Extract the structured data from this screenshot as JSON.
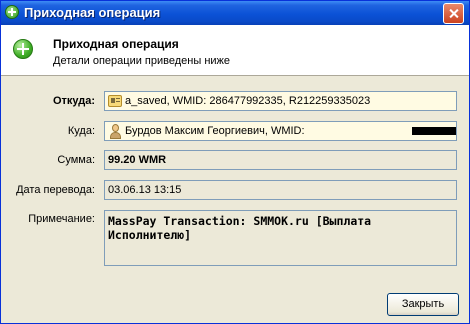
{
  "window": {
    "title": "Приходная операция",
    "close_icon": "close-icon",
    "app_icon": "add-circle-icon"
  },
  "header": {
    "title": "Приходная операция",
    "subtitle": "Детали операции приведены ниже",
    "icon": "add-circle-icon"
  },
  "form": {
    "from": {
      "label": "Откуда:",
      "value": "a_saved, WMID: 286477992335, R212259335023",
      "icon": "purse-icon"
    },
    "to": {
      "label": "Куда:",
      "value": "Бурдов Максим Георгиевич, WMID:",
      "icon": "person-icon"
    },
    "amount": {
      "label": "Сумма:",
      "value": "99.20 WMR"
    },
    "date": {
      "label": "Дата перевода:",
      "value": "03.06.13 13:15"
    },
    "note": {
      "label": "Примечание:",
      "value": "MassPay Transaction: SMMOK.ru [Выплата Исполнителю]"
    }
  },
  "buttons": {
    "close": "Закрыть"
  },
  "colors": {
    "titlebar": "#0b52d6",
    "background": "#ece9d8",
    "field_highlight": "#fffbe3"
  }
}
